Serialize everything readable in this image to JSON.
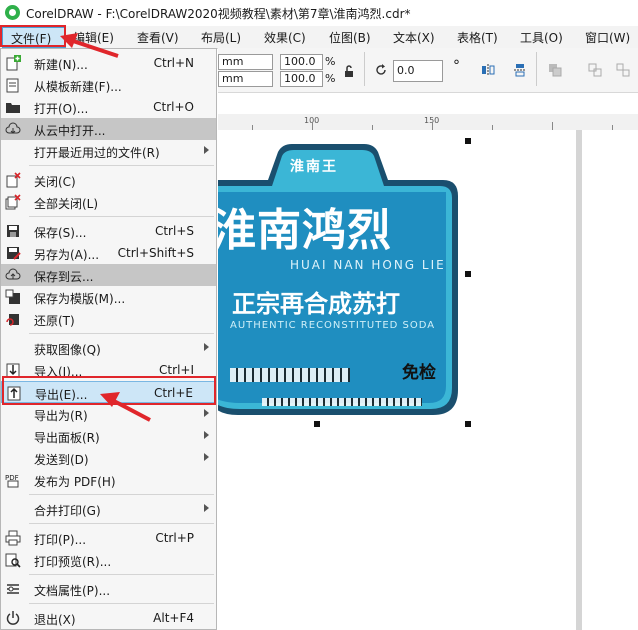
{
  "window": {
    "title": "CorelDRAW - F:\\CorelDRAW2020视频教程\\素材\\第7章\\淮南鸿烈.cdr*"
  },
  "menubar": {
    "file": "文件(F)",
    "edit": "编辑(E)",
    "view": "查看(V)",
    "layout": "布局(L)",
    "effects": "效果(C)",
    "bitmaps": "位图(B)",
    "text": "文本(X)",
    "table": "表格(T)",
    "tools": "工具(O)",
    "window": "窗口(W)"
  },
  "toolbar": {
    "unit1": "mm",
    "unit2": "mm",
    "scale1": "100.0",
    "scale2": "100.0",
    "pct1": "%",
    "pct2": "%",
    "rotation": "0.0",
    "degree": "°"
  },
  "ruler": {
    "t1": "100",
    "t2": "150"
  },
  "file_menu": {
    "items": [
      {
        "label": "新建(N)...",
        "shortcut": "Ctrl+N",
        "icon": "new-doc-icon"
      },
      {
        "label": "从模板新建(F)...",
        "shortcut": "",
        "icon": "template-icon"
      },
      {
        "label": "打开(O)...",
        "shortcut": "Ctrl+O",
        "icon": "folder-icon"
      },
      {
        "label": "从云中打开...",
        "shortcut": "",
        "icon": "cloud-download-icon"
      },
      {
        "label": "打开最近用过的文件(R)",
        "shortcut": "",
        "icon": ""
      },
      {
        "label": "关闭(C)",
        "shortcut": "",
        "icon": "close-doc-icon"
      },
      {
        "label": "全部关闭(L)",
        "shortcut": "",
        "icon": "close-all-icon"
      },
      {
        "label": "保存(S)...",
        "shortcut": "Ctrl+S",
        "icon": "save-icon"
      },
      {
        "label": "另存为(A)...",
        "shortcut": "Ctrl+Shift+S",
        "icon": "save-as-icon"
      },
      {
        "label": "保存到云...",
        "shortcut": "",
        "icon": "cloud-upload-icon"
      },
      {
        "label": "保存为模版(M)...",
        "shortcut": "",
        "icon": "save-template-icon"
      },
      {
        "label": "还原(T)",
        "shortcut": "",
        "icon": "revert-icon"
      },
      {
        "label": "获取图像(Q)",
        "shortcut": "",
        "icon": ""
      },
      {
        "label": "导入(I)...",
        "shortcut": "Ctrl+I",
        "icon": "import-icon"
      },
      {
        "label": "导出(E)...",
        "shortcut": "Ctrl+E",
        "icon": "export-icon"
      },
      {
        "label": "导出为(R)",
        "shortcut": "",
        "icon": ""
      },
      {
        "label": "导出面板(R)",
        "shortcut": "",
        "icon": ""
      },
      {
        "label": "发送到(D)",
        "shortcut": "",
        "icon": ""
      },
      {
        "label": "发布为 PDF(H)",
        "shortcut": "",
        "icon": "pdf-icon",
        "icon_text": "PDF"
      },
      {
        "label": "合并打印(G)",
        "shortcut": "",
        "icon": ""
      },
      {
        "label": "打印(P)...",
        "shortcut": "Ctrl+P",
        "icon": "print-icon"
      },
      {
        "label": "打印预览(R)...",
        "shortcut": "",
        "icon": "print-preview-icon"
      },
      {
        "label": "文档属性(P)...",
        "shortcut": "",
        "icon": "document-properties-icon"
      },
      {
        "label": "退出(X)",
        "shortcut": "Alt+F4",
        "icon": "power-icon"
      }
    ]
  },
  "artwork": {
    "top_tab": "淮南王",
    "title": "淮南鸿烈",
    "pinyin": "HUAI NAN HONG LIE",
    "slogan": "正宗再合成苏打",
    "english": "AUTHENTIC RECONSTITUTED SODA",
    "badge": "免检",
    "colors": {
      "teal": "#1f8ec0",
      "light_teal": "#3bb6d6",
      "dark_border": "#1a4f6e",
      "highlight": "#e0262b"
    }
  }
}
